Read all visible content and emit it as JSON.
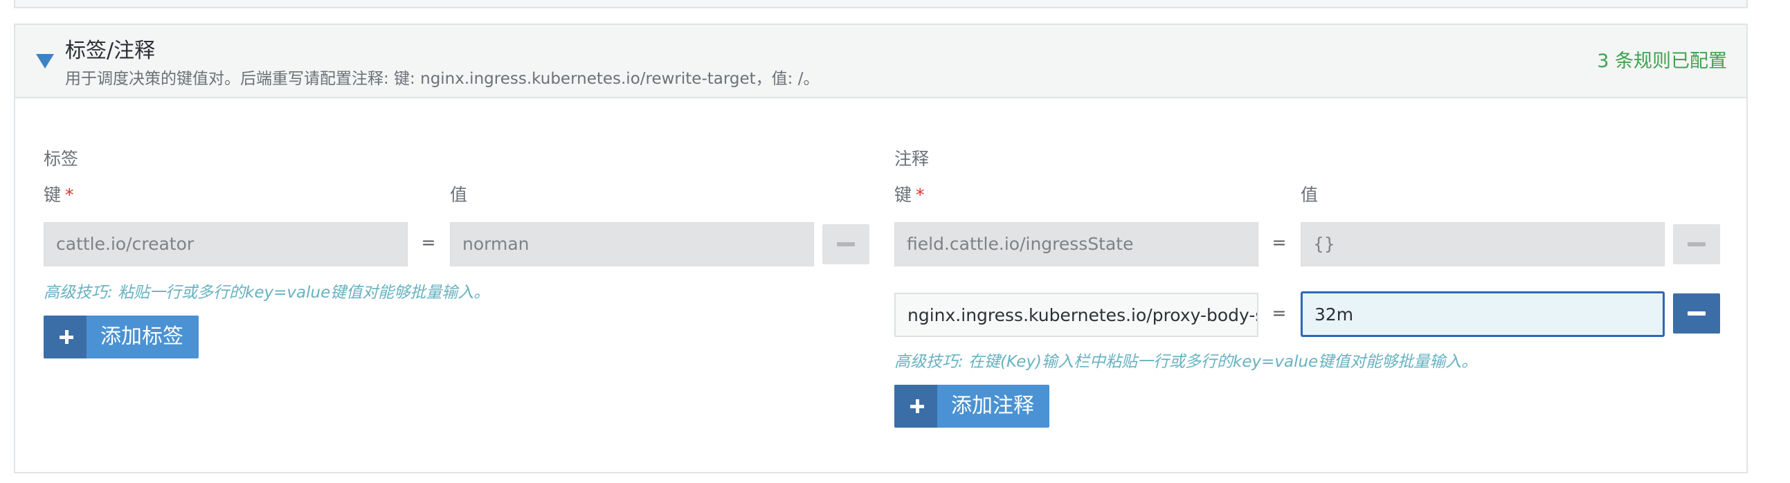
{
  "header": {
    "title": "标签/注释",
    "description": "用于调度决策的键值对。后端重写请配置注释: 键: nginx.ingress.kubernetes.io/rewrite-target，值: /。",
    "status": "3 条规则已配置"
  },
  "labels": {
    "section_title": "标签",
    "key_label": "键",
    "required_mark": "*",
    "value_label": "值",
    "rows": [
      {
        "key": "cattle.io/creator",
        "value": "norman"
      }
    ],
    "equals": "=",
    "hint": "高级技巧: 粘贴一行或多行的key=value键值对能够批量输入。",
    "add_button": "添加标签"
  },
  "annotations": {
    "section_title": "注释",
    "key_label": "键",
    "required_mark": "*",
    "value_label": "值",
    "rows": [
      {
        "key": "field.cattle.io/ingressState",
        "value": "{}"
      },
      {
        "key": "nginx.ingress.kubernetes.io/proxy-body-size",
        "value": "32m"
      }
    ],
    "equals": "=",
    "hint": "高级技巧: 在键(Key)输入栏中粘贴一行或多行的key=value键值对能够批量输入。",
    "add_button": "添加注释"
  },
  "colors": {
    "accent_blue": "#3d82c5",
    "button_blue": "#4a92d3",
    "button_dark": "#3b6ea7",
    "status_green": "#3fa24f",
    "hint_teal": "#67b2c1",
    "required_red": "#d9342b"
  },
  "icons": {
    "toggle": "caret-down-icon",
    "remove": "minus-icon",
    "add": "plus-icon"
  }
}
